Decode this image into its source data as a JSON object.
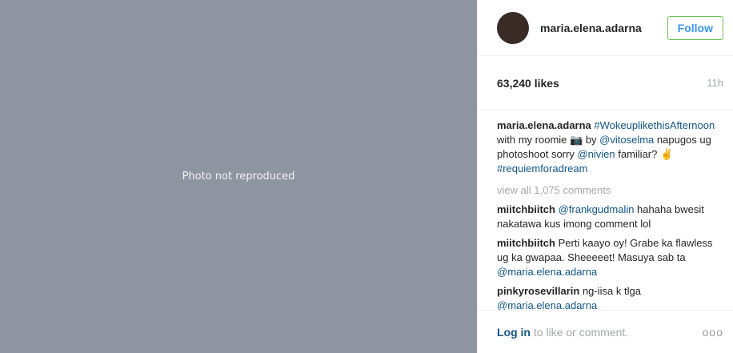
{
  "media": {
    "placeholder_label": "Photo not reproduced"
  },
  "header": {
    "username": "maria.elena.adarna",
    "follow_label": "Follow"
  },
  "stats": {
    "likes": "63,240 likes",
    "time": "11h"
  },
  "caption": {
    "username": "maria.elena.adarna",
    "tag1": "#WokeuplikethisAfternoon",
    "text1": " with my roomie 📷 by ",
    "mention1": "@vitoselma",
    "text2": " napugos ug photoshoot sorry ",
    "mention2": "@nivien",
    "text3": " familiar? ✌ ",
    "tag2": "#requiemforadream"
  },
  "view_all": "view all 1,075 comments",
  "comments": [
    {
      "username": "miitchbiitch",
      "mention": "@frankgudmalin",
      "text": " hahaha bwesit nakatawa kus imong comment lol"
    },
    {
      "username": "miitchbiitch",
      "text_a": " Perti kaayo oy! Grabe ka flawless ug ka gwapaa. Sheeeeet! Masuya sab ta ",
      "mention": "@maria.elena.adarna"
    },
    {
      "username": "pinkyrosevillarin",
      "text_a": " ng-iisa k tlga ",
      "mention": "@maria.elena.adarna"
    }
  ],
  "footer": {
    "login_label": "Log in",
    "login_rest": " to like or comment.",
    "more_label": "ooo"
  }
}
